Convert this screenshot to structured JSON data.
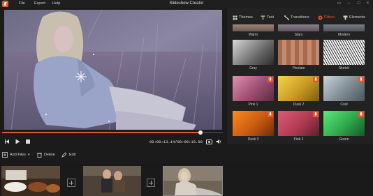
{
  "app": {
    "title": "Slideshow Creator",
    "menu": [
      "File",
      "Export",
      "Help"
    ]
  },
  "player": {
    "timecode": "00:00:13.14/00:00:15.00",
    "progress_fraction": 0.9
  },
  "tabs": [
    {
      "label": "Themes",
      "icon": "themes-icon"
    },
    {
      "label": "Text",
      "icon": "text-icon"
    },
    {
      "label": "Transitions",
      "icon": "transitions-icon"
    },
    {
      "label": "Filters",
      "icon": "filters-icon",
      "active": true
    },
    {
      "label": "Elements",
      "icon": "elements-icon"
    }
  ],
  "filters": {
    "row0": [
      "Warm",
      "Stars",
      "Modern"
    ],
    "row1": [
      "Gray",
      "Pixelate",
      "Sketch"
    ],
    "row2": [
      "Pink 1",
      "Dusk 2",
      "Cool"
    ],
    "row3": [
      "Dusk 3",
      "Pink 2",
      "Green"
    ]
  },
  "toolbar": {
    "add_files": "Add Files",
    "delete": "Delete",
    "edit": "Edit"
  },
  "colors": {
    "accent": "#e8572e",
    "background": "#1b1b1b",
    "panel": "#222222"
  }
}
